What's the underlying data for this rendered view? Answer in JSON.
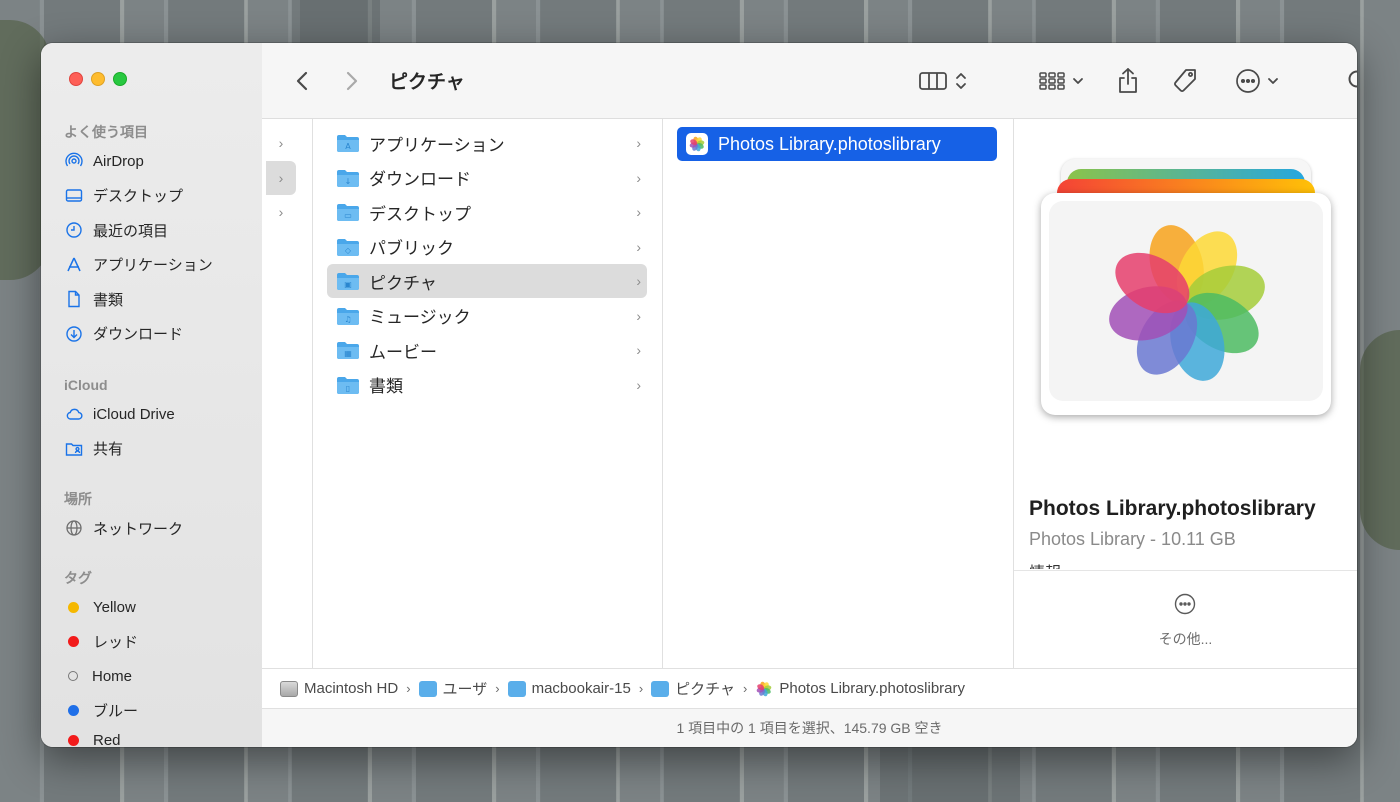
{
  "window": {
    "title": "ピクチャ"
  },
  "sidebar": {
    "sections": [
      {
        "header": "よく使う項目",
        "items": [
          {
            "label": "AirDrop",
            "icon": "airdrop-icon"
          },
          {
            "label": "デスクトップ",
            "icon": "desktop-icon"
          },
          {
            "label": "最近の項目",
            "icon": "clock-icon"
          },
          {
            "label": "アプリケーション",
            "icon": "applications-icon"
          },
          {
            "label": "書類",
            "icon": "document-icon"
          },
          {
            "label": "ダウンロード",
            "icon": "download-icon"
          }
        ]
      },
      {
        "header": "iCloud",
        "items": [
          {
            "label": "iCloud Drive",
            "icon": "cloud-icon"
          },
          {
            "label": "共有",
            "icon": "shared-folder-icon"
          }
        ]
      },
      {
        "header": "場所",
        "items": [
          {
            "label": "ネットワーク",
            "icon": "globe-icon"
          }
        ]
      },
      {
        "header": "タグ",
        "items": [
          {
            "label": "Yellow",
            "color": "#f5b800"
          },
          {
            "label": "レッド",
            "color": "#f21b1b"
          },
          {
            "label": "Home",
            "color": "hollow"
          },
          {
            "label": "ブルー",
            "color": "#1f6fe8"
          },
          {
            "label": "Red",
            "color": "#f21b1b"
          }
        ]
      }
    ]
  },
  "toolbar": {
    "back_icon": "chevron-left-icon",
    "forward_icon": "chevron-right-icon",
    "view_icon": "column-view-icon",
    "group_icon": "grid-group-icon",
    "share_icon": "share-icon",
    "tag_icon": "tag-icon",
    "more_icon": "ellipsis-circle-icon",
    "search_icon": "search-icon"
  },
  "columns": {
    "folders": [
      {
        "label": "アプリケーション",
        "glyph": "A"
      },
      {
        "label": "ダウンロード",
        "glyph": "↓"
      },
      {
        "label": "デスクトップ",
        "glyph": "▭"
      },
      {
        "label": "パブリック",
        "glyph": "◇"
      },
      {
        "label": "ピクチャ",
        "glyph": "▣",
        "selected": true
      },
      {
        "label": "ミュージック",
        "glyph": "♫"
      },
      {
        "label": "ムービー",
        "glyph": "▦"
      },
      {
        "label": "書類",
        "glyph": "▯"
      }
    ],
    "files": [
      {
        "label": "Photos Library.photoslibrary",
        "selected": true
      }
    ]
  },
  "preview": {
    "name": "Photos Library.photoslibrary",
    "meta": "Photos Library - 10.11 GB",
    "info_label": "情報",
    "more_label": "その他..."
  },
  "pathbar": [
    {
      "label": "Macintosh HD",
      "icon": "hard-drive-icon"
    },
    {
      "label": "ユーザ",
      "icon": "folder-icon"
    },
    {
      "label": "macbookair-15",
      "icon": "home-folder-icon"
    },
    {
      "label": "ピクチャ",
      "icon": "pictures-folder-icon"
    },
    {
      "label": "Photos Library.photoslibrary",
      "icon": "photos-icon"
    }
  ],
  "status": {
    "text": "1 項目中の 1 項目を選択、145.79 GB 空き"
  }
}
